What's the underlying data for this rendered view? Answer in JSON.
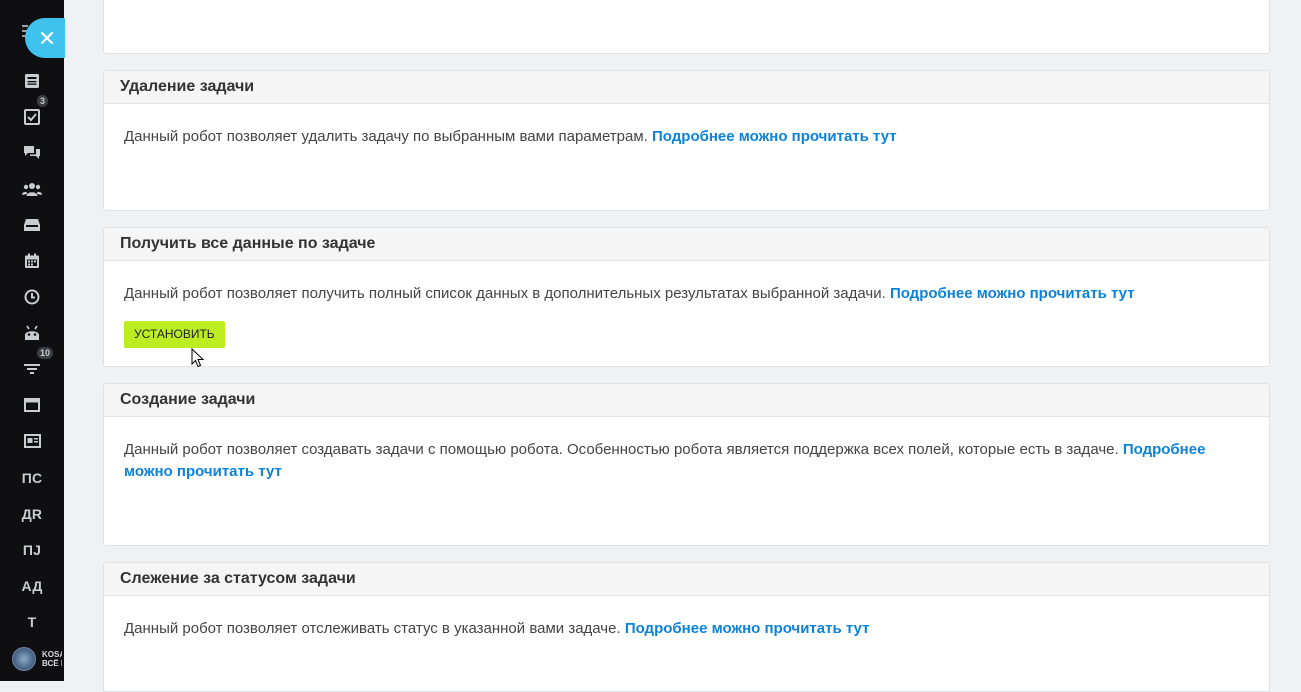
{
  "sidebar": {
    "badges": {
      "tasks": "3",
      "filter": "10"
    },
    "text_items": [
      "ПС",
      "ДR",
      "ПЈ",
      "АД",
      "Т"
    ],
    "footer_text_line1": "KOSA",
    "footer_text_line2": "ВСЁ Н"
  },
  "link_label": "Подробнее можно прочитать тут",
  "cards": [
    {
      "title": "Удаление задачи",
      "text": "Данный робот позволяет удалить задачу по выбранным вами параметрам."
    },
    {
      "title": "Получить все данные по задаче",
      "text": "Данный робот позволяет получить полный список данных в дополнительных результатах выбранной задачи.",
      "button": "Установить"
    },
    {
      "title": "Создание задачи",
      "text": "Данный робот позволяет создавать задачи с помощью робота. Особенностью робота является поддержка всех полей, которые есть в задаче."
    },
    {
      "title": "Слежение за статусом задачи",
      "text": "Данный робот позволяет отслеживать статус в указанной вами задаче."
    }
  ],
  "colors": {
    "accent_link": "#0b82dc",
    "install_button": "#bbed21",
    "sidebar_bg": "#0f0f11",
    "close_bubble": "#3fc3ee"
  }
}
